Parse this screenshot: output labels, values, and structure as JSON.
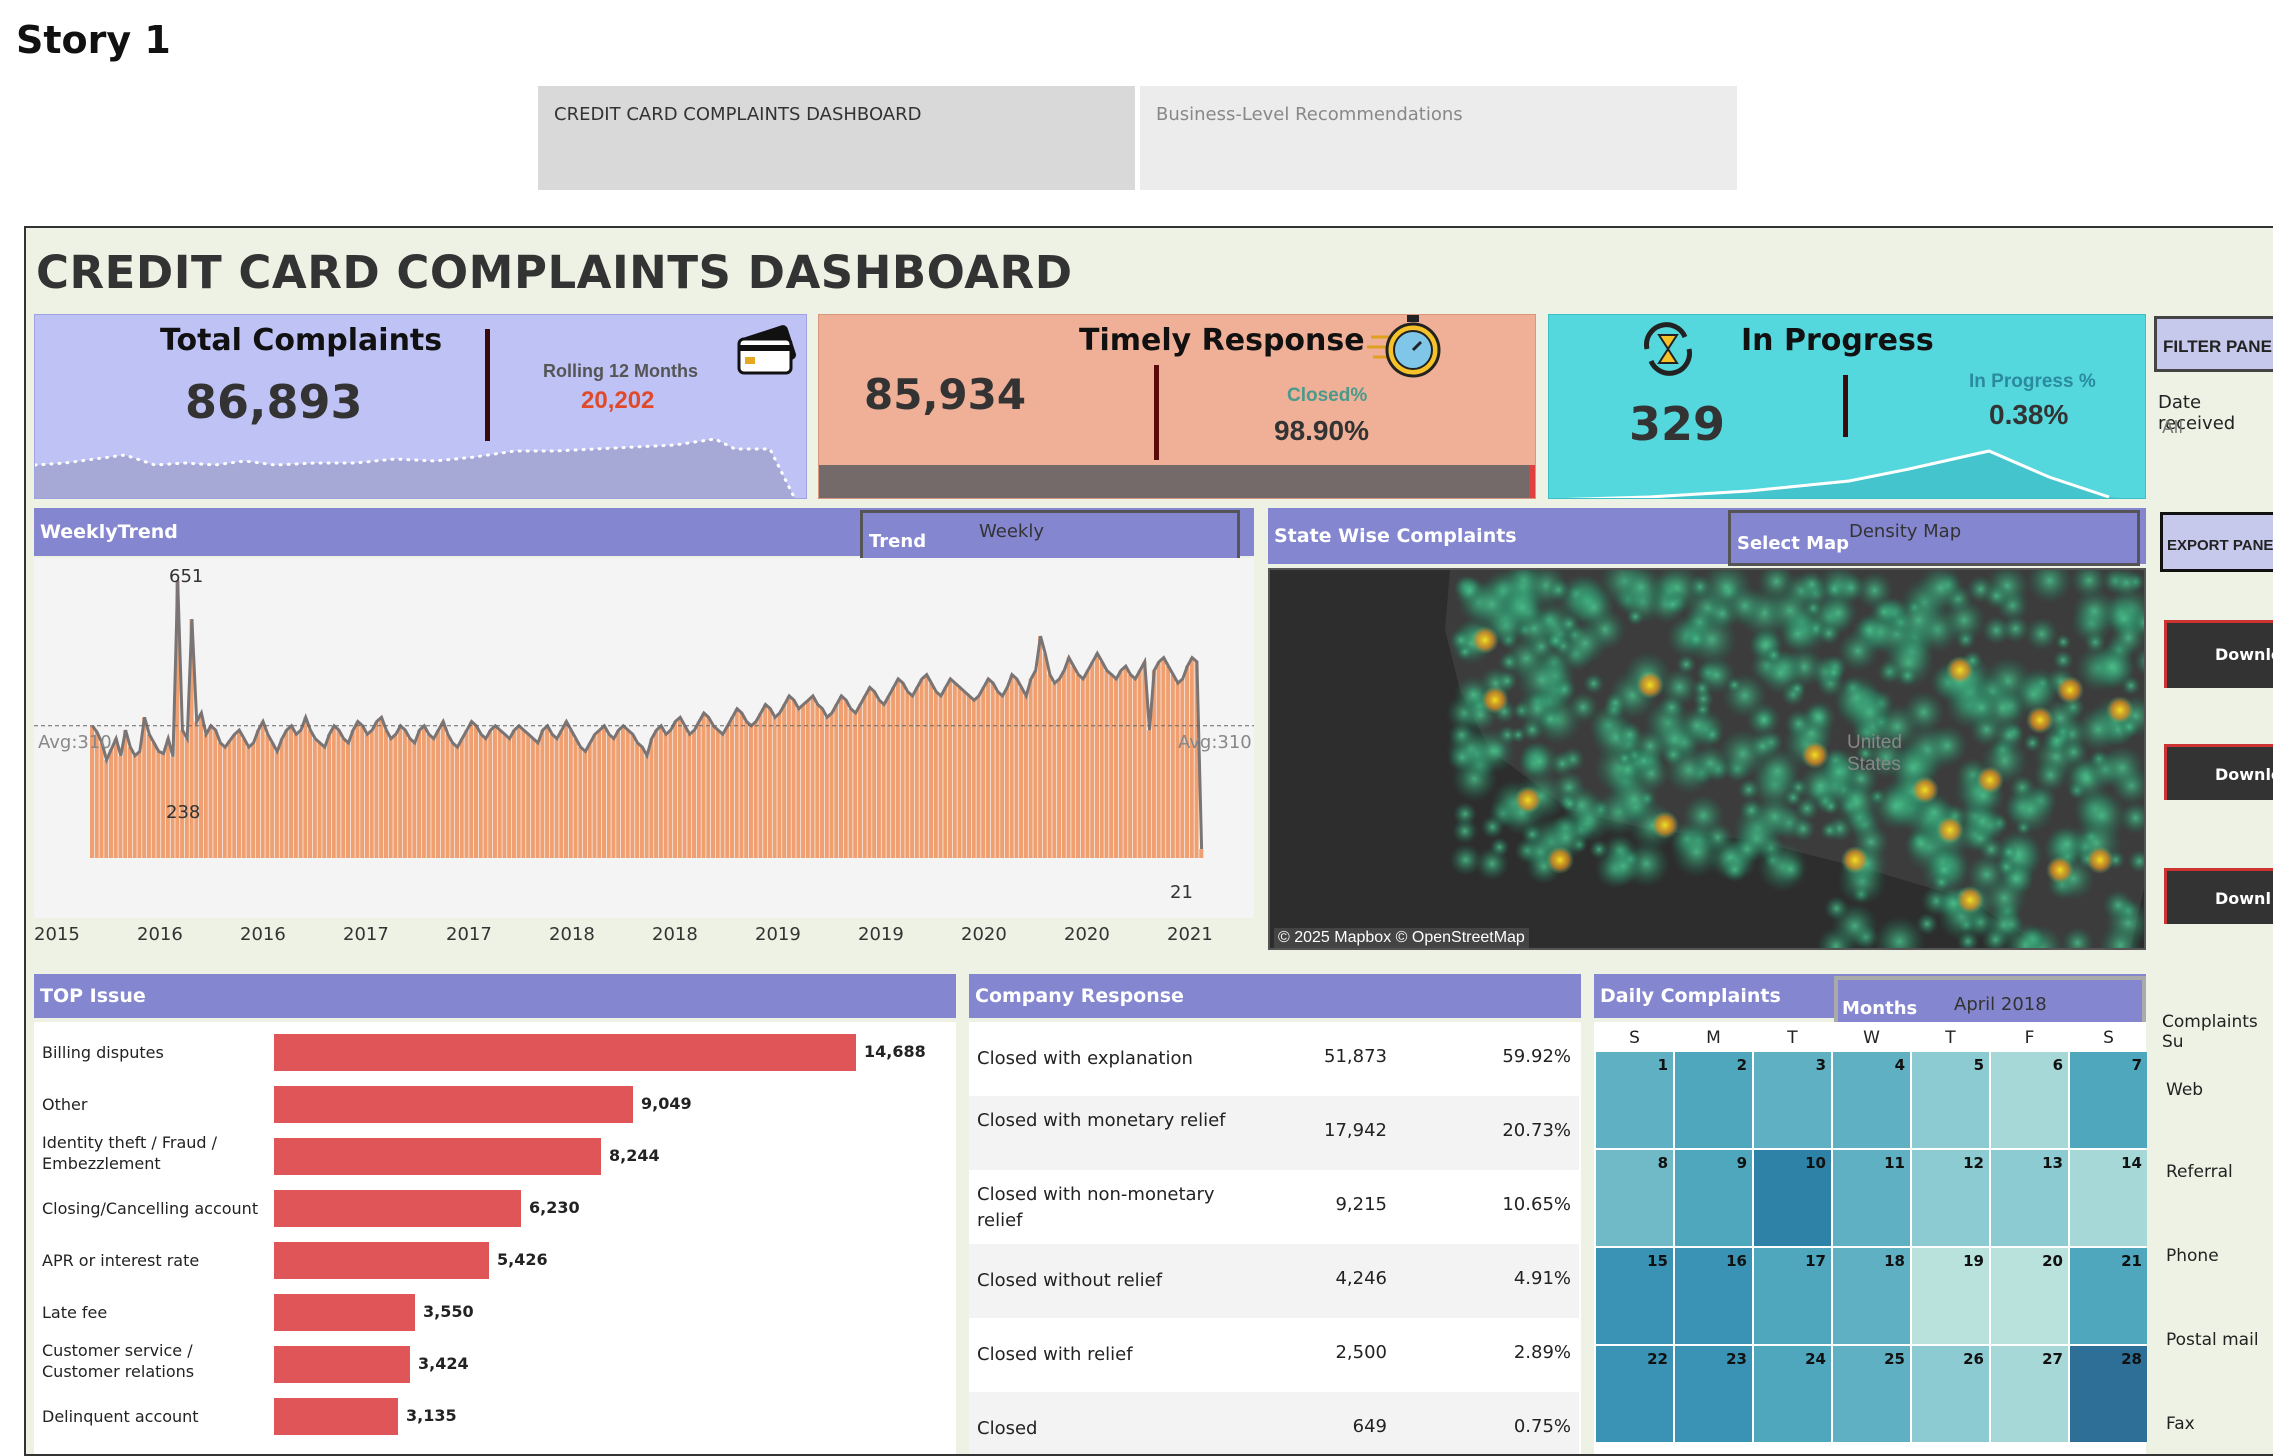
{
  "story": {
    "title": "Story 1",
    "tabs": [
      "CREDIT CARD COMPLAINTS DASHBOARD",
      "Business-Level Recommendations"
    ]
  },
  "dashboard": {
    "title": "CREDIT CARD COMPLAINTS DASHBOARD"
  },
  "kpis": {
    "total": {
      "title": "Total Complaints",
      "value": "86,893",
      "sub_label": "Rolling 12 Months",
      "sub_value": "20,202",
      "icon": "credit-card-icon"
    },
    "timely": {
      "title": "Timely Response",
      "value": "85,934",
      "sub_label": "Closed%",
      "sub_value": "98.90%",
      "icon": "stopwatch-icon"
    },
    "progress": {
      "title": "In Progress",
      "value": "329",
      "sub_label": "In Progress %",
      "sub_value": "0.38%",
      "icon": "hourglass-refresh-icon"
    }
  },
  "weekly": {
    "header": "WeeklyTrend",
    "selector_label": "Trend",
    "selector_value": "Weekly",
    "annotations": {
      "max": "651",
      "min_mid": "238",
      "avg_left": "Avg:310",
      "avg_right": "Avg:310",
      "last": "21"
    },
    "x_labels": [
      "2015",
      "2016",
      "2016",
      "2017",
      "2017",
      "2018",
      "2018",
      "2019",
      "2019",
      "2020",
      "2020",
      "2021"
    ]
  },
  "map": {
    "header": "State Wise Complaints",
    "selector_label": "Select Map",
    "selector_value": "Density Map",
    "country_label_1": "United",
    "country_label_2": "States",
    "credit": "© 2025 Mapbox © OpenStreetMap"
  },
  "side": {
    "filter_header": "FILTER PANEL",
    "date_label": "Date received",
    "date_value": "All",
    "export_header": "EXPORT PANEL",
    "downloads": [
      "Downlo",
      "Downlo",
      "Downl"
    ],
    "complaints_sub": "Complaints Su",
    "channels": [
      "Web",
      "Referral",
      "Phone",
      "Postal mail",
      "Fax"
    ]
  },
  "top_issue": {
    "header": "TOP Issue",
    "items": [
      {
        "label": "Billing disputes",
        "value": "14,688",
        "n": 14688
      },
      {
        "label": "Other",
        "value": "9,049",
        "n": 9049
      },
      {
        "label": "Identity theft / Fraud / Embezzlement",
        "value": "8,244",
        "n": 8244
      },
      {
        "label": "Closing/Cancelling account",
        "value": "6,230",
        "n": 6230
      },
      {
        "label": "APR or interest rate",
        "value": "5,426",
        "n": 5426
      },
      {
        "label": "Late fee",
        "value": "3,550",
        "n": 3550
      },
      {
        "label": "Customer service / Customer relations",
        "value": "3,424",
        "n": 3424
      },
      {
        "label": "Delinquent account",
        "value": "3,135",
        "n": 3135
      }
    ]
  },
  "company_response": {
    "header": "Company Response",
    "rows": [
      {
        "name": "Closed with explanation",
        "count": "51,873",
        "pct": "59.92%"
      },
      {
        "name": "Closed with monetary relief",
        "count": "17,942",
        "pct": "20.73%"
      },
      {
        "name": "Closed with non-monetary relief",
        "count": "9,215",
        "pct": "10.65%"
      },
      {
        "name": "Closed without relief",
        "count": "4,246",
        "pct": "4.91%"
      },
      {
        "name": "Closed with relief",
        "count": "2,500",
        "pct": "2.89%"
      },
      {
        "name": "Closed",
        "count": "649",
        "pct": "0.75%"
      }
    ]
  },
  "daily": {
    "header": "Daily Complaints",
    "selector_label": "Months",
    "selector_value": "April 2018",
    "dow": [
      "S",
      "M",
      "T",
      "W",
      "T",
      "F",
      "S"
    ],
    "days": [
      "1",
      "2",
      "3",
      "4",
      "5",
      "6",
      "7",
      "8",
      "9",
      "10",
      "11",
      "12",
      "13",
      "14",
      "15",
      "16",
      "17",
      "18",
      "19",
      "20",
      "21",
      "22",
      "23",
      "24",
      "25",
      "26",
      "27",
      "28"
    ],
    "colors": [
      "#5fb0c2",
      "#4ea7bd",
      "#5fb0c2",
      "#5fb0c2",
      "#8ccbd1",
      "#a6d8d8",
      "#4ea7bd",
      "#6fbac6",
      "#4ea7bd",
      "#2e82a8",
      "#5fb0c2",
      "#8ccbd1",
      "#8ccbd1",
      "#a6d8d8",
      "#3a93b5",
      "#3a93b5",
      "#4ea7bd",
      "#5fb0c2",
      "#b9e2dc",
      "#b9e2dc",
      "#4ea7bd",
      "#3a93b5",
      "#3a93b5",
      "#4ea7bd",
      "#5fb0c2",
      "#8ccbd1",
      "#a6d8d8",
      "#2e6f97"
    ]
  },
  "chart_data": {
    "type": "area",
    "title": "WeeklyTrend",
    "x_start": "2015",
    "x_end": "2021",
    "avg": 310,
    "max": 651,
    "min_labeled": 238,
    "last": 21,
    "values": [
      310,
      295,
      270,
      230,
      255,
      280,
      240,
      300,
      260,
      240,
      250,
      330,
      290,
      270,
      250,
      245,
      280,
      238,
      651,
      300,
      280,
      560,
      320,
      340,
      290,
      310,
      300,
      270,
      260,
      275,
      290,
      300,
      280,
      260,
      270,
      300,
      320,
      290,
      270,
      250,
      280,
      300,
      310,
      290,
      300,
      330,
      300,
      280,
      270,
      260,
      290,
      310,
      300,
      280,
      270,
      300,
      320,
      310,
      290,
      300,
      320,
      330,
      300,
      280,
      290,
      310,
      300,
      280,
      270,
      300,
      310,
      290,
      280,
      300,
      320,
      290,
      270,
      260,
      280,
      300,
      320,
      310,
      290,
      280,
      300,
      310,
      300,
      290,
      280,
      300,
      310,
      300,
      290,
      280,
      270,
      300,
      310,
      290,
      280,
      300,
      320,
      300,
      280,
      260,
      250,
      270,
      290,
      300,
      310,
      290,
      280,
      300,
      310,
      300,
      290,
      270,
      260,
      240,
      280,
      300,
      310,
      290,
      300,
      320,
      330,
      310,
      290,
      300,
      320,
      340,
      330,
      310,
      300,
      290,
      310,
      330,
      350,
      340,
      320,
      310,
      320,
      340,
      360,
      350,
      330,
      340,
      360,
      380,
      370,
      350,
      360,
      370,
      380,
      360,
      350,
      330,
      340,
      360,
      380,
      370,
      350,
      340,
      360,
      380,
      400,
      390,
      370,
      360,
      380,
      400,
      420,
      410,
      390,
      380,
      400,
      420,
      430,
      410,
      390,
      380,
      400,
      420,
      410,
      400,
      390,
      380,
      370,
      380,
      400,
      420,
      410,
      390,
      380,
      400,
      430,
      420,
      400,
      380,
      420,
      440,
      520,
      480,
      430,
      410,
      420,
      440,
      470,
      450,
      430,
      420,
      440,
      460,
      480,
      460,
      440,
      430,
      420,
      440,
      450,
      430,
      420,
      440,
      460,
      300,
      440,
      460,
      470,
      450,
      430,
      410,
      420,
      450,
      470,
      460,
      21
    ]
  }
}
